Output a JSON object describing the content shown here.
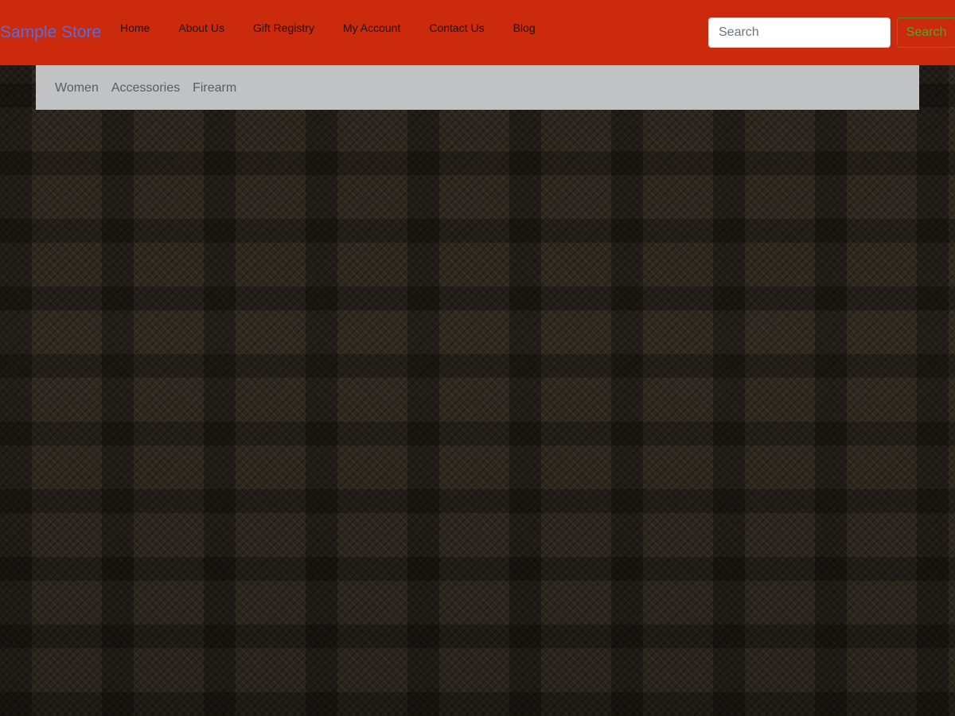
{
  "header": {
    "brand": "Sample Store",
    "nav": [
      "Home",
      "About Us",
      "Gift Registry",
      "My Account",
      "Contact Us",
      "Blog"
    ],
    "search": {
      "placeholder": "Search",
      "button_label": "Search"
    }
  },
  "categories": [
    "Women",
    "Accessories",
    "Firearm"
  ],
  "colors": {
    "header_bg": "#cc2a0c",
    "brand": "#5b6bd8",
    "subnav_bg": "#c1c2c4",
    "search_button": "#5aa321"
  }
}
